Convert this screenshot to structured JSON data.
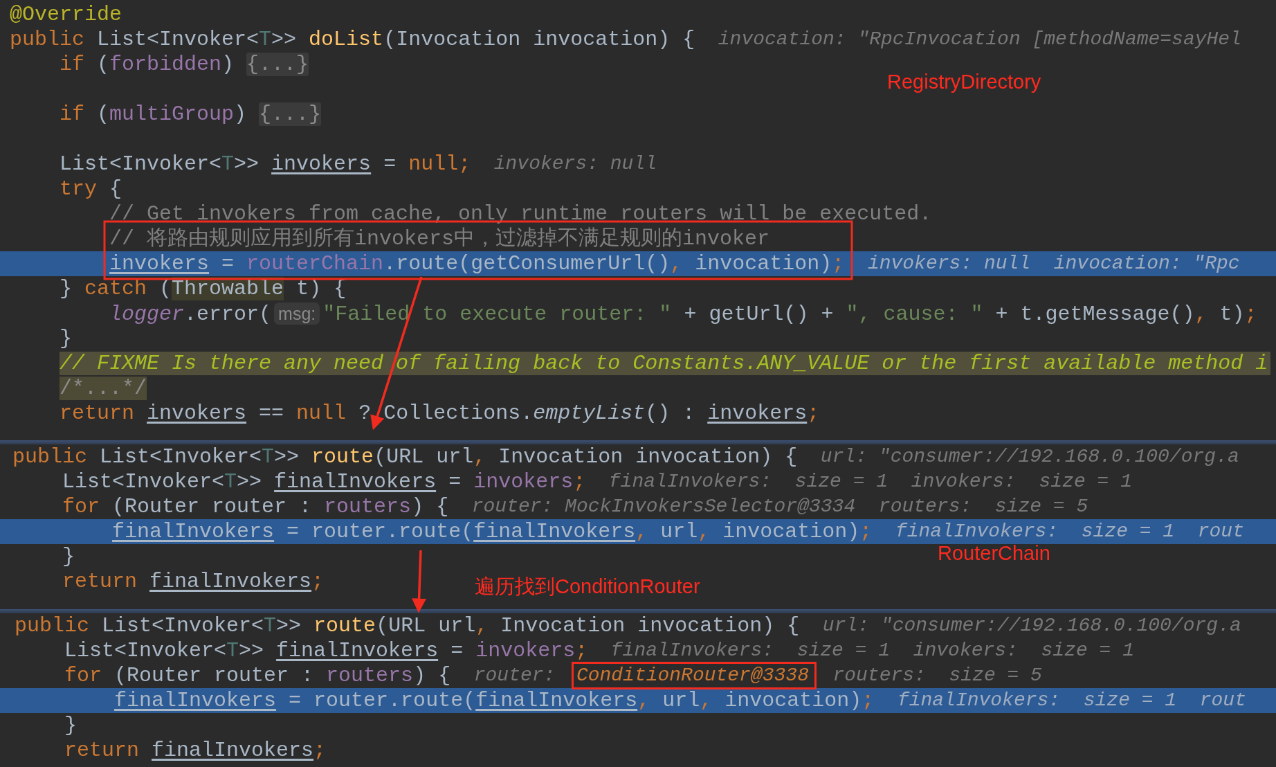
{
  "panels": [
    {
      "lines": [
        {
          "current": false,
          "tokens": [
            {
              "kind": "ann",
              "text": "@Override"
            }
          ]
        },
        {
          "current": false,
          "tokens": [
            {
              "kind": "kw",
              "text": "public "
            },
            {
              "kind": "pl",
              "text": "List<Invoker<"
            },
            {
              "kind": "gen",
              "text": "T"
            },
            {
              "kind": "pl",
              "text": ">> "
            },
            {
              "kind": "decl",
              "text": "doList"
            },
            {
              "kind": "pl",
              "text": "(Invocation invocation) {"
            }
          ],
          "hint": [
            {
              "kind": "hint",
              "text": "invocation: \"RpcInvocation [methodName=sayHel"
            }
          ]
        },
        {
          "current": false,
          "tokens": [
            {
              "kind": "kw",
              "text": "    if "
            },
            {
              "kind": "pl",
              "text": "("
            },
            {
              "kind": "fld",
              "text": "forbidden"
            },
            {
              "kind": "pl",
              "text": ") "
            },
            {
              "kind": "fold",
              "text": "{...}"
            }
          ]
        },
        {
          "current": false
        },
        {
          "current": false,
          "tokens": [
            {
              "kind": "kw",
              "text": "    if "
            },
            {
              "kind": "pl",
              "text": "("
            },
            {
              "kind": "fld",
              "text": "multiGroup"
            },
            {
              "kind": "pl",
              "text": ") "
            },
            {
              "kind": "fold",
              "text": "{...}"
            }
          ]
        },
        {
          "current": false
        },
        {
          "current": false,
          "tokens": [
            {
              "kind": "pl",
              "text": "    List<Invoker<"
            },
            {
              "kind": "gen",
              "text": "T"
            },
            {
              "kind": "pl",
              "text": ">> "
            },
            {
              "kind": "var",
              "text": "invokers"
            },
            {
              "kind": "pl",
              "text": " = "
            },
            {
              "kind": "kw",
              "text": "null;"
            }
          ],
          "hint": [
            {
              "kind": "hint",
              "text": "invokers: null"
            }
          ]
        },
        {
          "current": false,
          "tokens": [
            {
              "kind": "kw",
              "text": "    try "
            },
            {
              "kind": "pl",
              "text": "{"
            }
          ]
        },
        {
          "current": false,
          "tokens": [
            {
              "kind": "cmt",
              "text": "        // Get invokers from cache, only runtime routers will be executed."
            }
          ]
        },
        {
          "current": false,
          "tokens": [
            {
              "kind": "cmt",
              "text": "        // 将路由规则应用到所有invokers中，过滤掉不满足规则的invoker"
            }
          ]
        },
        {
          "current": true,
          "tokens": [
            {
              "kind": "var",
              "text": "        invokers"
            },
            {
              "kind": "pl",
              "text": " = "
            },
            {
              "kind": "fld",
              "text": "routerChain"
            },
            {
              "kind": "pl",
              "text": ".route(getConsumerUrl()"
            },
            {
              "kind": "kw",
              "text": ", "
            },
            {
              "kind": "pl",
              "text": "invocation)"
            },
            {
              "kind": "kw",
              "text": ";"
            }
          ],
          "hint": [
            {
              "kind": "hint",
              "text": "invokers: null  invocation: \"Rpc"
            }
          ]
        },
        {
          "current": false,
          "tokens": [
            {
              "kind": "pl",
              "text": "    } "
            },
            {
              "kind": "kw",
              "text": "catch "
            },
            {
              "kind": "pl",
              "text": "("
            },
            {
              "kind": "hl",
              "text": "Throwable"
            },
            {
              "kind": "pl",
              "text": " t) {"
            }
          ]
        },
        {
          "current": false,
          "tokens": [
            {
              "kind": "fldi",
              "text": "        logger"
            },
            {
              "kind": "pl",
              "text": ".error("
            },
            {
              "kind": "param",
              "text": "msg:"
            },
            {
              "kind": "str",
              "text": "\"Failed to execute router: \""
            },
            {
              "kind": "pl",
              "text": " + getUrl() + "
            },
            {
              "kind": "str",
              "text": "\", cause: \""
            },
            {
              "kind": "pl",
              "text": " + t.getMessage()"
            },
            {
              "kind": "kw",
              "text": ", "
            },
            {
              "kind": "pl",
              "text": "t)"
            },
            {
              "kind": "kw",
              "text": ";"
            }
          ]
        },
        {
          "current": false,
          "tokens": [
            {
              "kind": "pl",
              "text": "    }"
            }
          ]
        },
        {
          "current": false,
          "tokens": [
            {
              "kind": "fixme",
              "text": "    // FIXME Is there any need of failing back to Constants.ANY_VALUE or the first available method i"
            }
          ]
        },
        {
          "current": false,
          "tokens": [
            {
              "kind": "foldc",
              "text": "    /*...*/"
            }
          ]
        },
        {
          "current": false,
          "tokens": [
            {
              "kind": "kw",
              "text": "    return "
            },
            {
              "kind": "var",
              "text": "invokers"
            },
            {
              "kind": "pl",
              "text": " == "
            },
            {
              "kind": "kw",
              "text": "null "
            },
            {
              "kind": "pl",
              "text": "? Collections."
            },
            {
              "kind": "ital",
              "text": "emptyList"
            },
            {
              "kind": "pl",
              "text": "() : "
            },
            {
              "kind": "var",
              "text": "invokers"
            },
            {
              "kind": "kw",
              "text": ";"
            }
          ]
        }
      ]
    },
    {
      "lines": [
        {
          "current": false,
          "tokens": [
            {
              "kind": "kw",
              "text": "public "
            },
            {
              "kind": "pl",
              "text": "List<Invoker<"
            },
            {
              "kind": "gen",
              "text": "T"
            },
            {
              "kind": "pl",
              "text": ">> "
            },
            {
              "kind": "decl",
              "text": "route"
            },
            {
              "kind": "pl",
              "text": "(URL url"
            },
            {
              "kind": "kw",
              "text": ", "
            },
            {
              "kind": "pl",
              "text": "Invocation invocation) {"
            }
          ],
          "hint": [
            {
              "kind": "hint",
              "text": "url: \"consumer://192.168.0.100/org.a"
            }
          ]
        },
        {
          "current": false,
          "tokens": [
            {
              "kind": "pl",
              "text": "    List<Invoker<"
            },
            {
              "kind": "gen",
              "text": "T"
            },
            {
              "kind": "pl",
              "text": ">> "
            },
            {
              "kind": "var",
              "text": "finalInvokers"
            },
            {
              "kind": "pl",
              "text": " = "
            },
            {
              "kind": "fld",
              "text": "invokers"
            },
            {
              "kind": "kw",
              "text": ";"
            }
          ],
          "hint": [
            {
              "kind": "hint",
              "text": "finalInvokers:  size = 1  invokers:  size = 1"
            }
          ]
        },
        {
          "current": false,
          "tokens": [
            {
              "kind": "kw",
              "text": "    for "
            },
            {
              "kind": "pl",
              "text": "(Router router : "
            },
            {
              "kind": "fld",
              "text": "routers"
            },
            {
              "kind": "pl",
              "text": ") {"
            }
          ],
          "hint": [
            {
              "kind": "hint",
              "text": "router: MockInvokersSelector@3334  routers:  size = 5"
            }
          ]
        },
        {
          "current": true,
          "tokens": [
            {
              "kind": "var",
              "text": "        finalInvokers"
            },
            {
              "kind": "pl",
              "text": " = router.route("
            },
            {
              "kind": "var",
              "text": "finalInvokers"
            },
            {
              "kind": "kw",
              "text": ", "
            },
            {
              "kind": "pl",
              "text": "url"
            },
            {
              "kind": "kw",
              "text": ", "
            },
            {
              "kind": "pl",
              "text": "invocation)"
            },
            {
              "kind": "kw",
              "text": ";"
            }
          ],
          "hint": [
            {
              "kind": "hint",
              "text": "finalInvokers:  size = 1  rout"
            }
          ]
        },
        {
          "current": false,
          "tokens": [
            {
              "kind": "pl",
              "text": "    }"
            }
          ]
        },
        {
          "current": false,
          "tokens": [
            {
              "kind": "kw",
              "text": "    return "
            },
            {
              "kind": "var",
              "text": "finalInvokers"
            },
            {
              "kind": "kw",
              "text": ";"
            }
          ]
        }
      ]
    },
    {
      "lines": [
        {
          "current": false,
          "tokens": [
            {
              "kind": "kw",
              "text": "public "
            },
            {
              "kind": "pl",
              "text": "List<Invoker<"
            },
            {
              "kind": "gen",
              "text": "T"
            },
            {
              "kind": "pl",
              "text": ">> "
            },
            {
              "kind": "decl",
              "text": "route"
            },
            {
              "kind": "pl",
              "text": "(URL url"
            },
            {
              "kind": "kw",
              "text": ", "
            },
            {
              "kind": "pl",
              "text": "Invocation invocation) {"
            }
          ],
          "hint": [
            {
              "kind": "hint",
              "text": "url: \"consumer://192.168.0.100/org.a"
            }
          ]
        },
        {
          "current": false,
          "tokens": [
            {
              "kind": "pl",
              "text": "    List<Invoker<"
            },
            {
              "kind": "gen",
              "text": "T"
            },
            {
              "kind": "pl",
              "text": ">> "
            },
            {
              "kind": "var",
              "text": "finalInvokers"
            },
            {
              "kind": "pl",
              "text": " = "
            },
            {
              "kind": "fld",
              "text": "invokers"
            },
            {
              "kind": "kw",
              "text": ";"
            }
          ],
          "hint": [
            {
              "kind": "hint",
              "text": "finalInvokers:  size = 1  invokers:  size = 1"
            }
          ]
        },
        {
          "current": false,
          "tokens": [
            {
              "kind": "kw",
              "text": "    for "
            },
            {
              "kind": "pl",
              "text": "(Router router : "
            },
            {
              "kind": "fld",
              "text": "routers"
            },
            {
              "kind": "pl",
              "text": ") {"
            }
          ],
          "hint": [
            {
              "kind": "hint",
              "text": "router:"
            },
            {
              "kind": "changed",
              "text": "ConditionRouter@3338"
            },
            {
              "kind": "hint",
              "text": "routers:  size = 5"
            }
          ]
        },
        {
          "current": true,
          "tokens": [
            {
              "kind": "var",
              "text": "        finalInvokers"
            },
            {
              "kind": "pl",
              "text": " = router.route("
            },
            {
              "kind": "var",
              "text": "finalInvokers"
            },
            {
              "kind": "kw",
              "text": ", "
            },
            {
              "kind": "pl",
              "text": "url"
            },
            {
              "kind": "kw",
              "text": ", "
            },
            {
              "kind": "pl",
              "text": "invocation)"
            },
            {
              "kind": "kw",
              "text": ";"
            }
          ],
          "hint": [
            {
              "kind": "hint",
              "text": "finalInvokers:  size = 1  rout"
            }
          ]
        },
        {
          "current": false,
          "tokens": [
            {
              "kind": "pl",
              "text": "    }"
            }
          ]
        },
        {
          "current": false,
          "tokens": [
            {
              "kind": "kw",
              "text": "    return "
            },
            {
              "kind": "var",
              "text": "finalInvokers"
            },
            {
              "kind": "kw",
              "text": ";"
            }
          ]
        }
      ]
    }
  ],
  "annotations": [
    {
      "text": "RegistryDirectory"
    },
    {
      "text": "RouterChain"
    },
    {
      "text": "遍历找到ConditionRouter"
    }
  ]
}
